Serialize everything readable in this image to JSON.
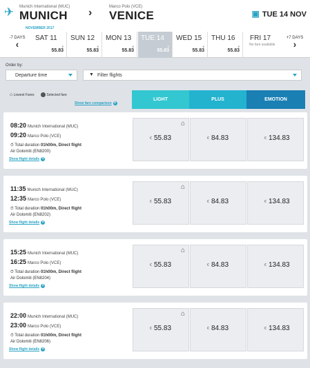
{
  "header": {
    "from_small": "Munich International (MUC)",
    "from_big": "MUNICH",
    "to_small": "Marco Polo (VCE)",
    "to_big": "VENICE",
    "date": "TUE 14 NOV"
  },
  "datebar": {
    "month": "NOVEMBER 2017",
    "prev_label": "-7 DAYS",
    "next_label": "+7 DAYS",
    "days": [
      {
        "name": "SAT 11",
        "currency": "€",
        "price": "55.83",
        "available": true
      },
      {
        "name": "SUN 12",
        "currency": "€",
        "price": "55.83",
        "available": true
      },
      {
        "name": "MON 13",
        "currency": "€",
        "price": "55.83",
        "available": true
      },
      {
        "name": "TUE 14",
        "currency": "€",
        "price": "55.83",
        "available": true
      },
      {
        "name": "WED 15",
        "currency": "€",
        "price": "55.83",
        "available": true
      },
      {
        "name": "THU 16",
        "currency": "€",
        "price": "55.83",
        "available": true
      },
      {
        "name": "FRI 17",
        "note": "No fare available",
        "available": false
      }
    ]
  },
  "filters": {
    "order_by_label": "Order by:",
    "order_value": "Departure time",
    "filter_label": "Filter flights",
    "lowest_fares": "Lowest Fares",
    "selected_fare": "Selected fare",
    "show_comparison": "Show fare comparison"
  },
  "fare_columns": [
    {
      "label": "LIGHT",
      "color": "#33c7d1"
    },
    {
      "label": "PLUS",
      "color": "#23b3cf"
    },
    {
      "label": "EMOTION",
      "color": "#1a7fb3"
    }
  ],
  "flights": [
    {
      "dep_time": "08:20",
      "dep_place": "Munich International (MUC)",
      "arr_time": "09:20",
      "arr_place": "Marco Polo (VCE)",
      "duration_label": "Total duration",
      "duration": "01h00m, Direct flight",
      "airline": "Air Dolomiti (EN8200)",
      "details": "Show flight details",
      "fares": [
        {
          "currency": "€",
          "price": "55.83"
        },
        {
          "currency": "€",
          "price": "84.83"
        },
        {
          "currency": "€",
          "price": "134.83"
        }
      ]
    },
    {
      "dep_time": "11:35",
      "dep_place": "Munich International (MUC)",
      "arr_time": "12:35",
      "arr_place": "Marco Polo (VCE)",
      "duration_label": "Total duration",
      "duration": "01h00m, Direct flight",
      "airline": "Air Dolomiti (EN8202)",
      "details": "Show flight details",
      "fares": [
        {
          "currency": "€",
          "price": "55.83"
        },
        {
          "currency": "€",
          "price": "84.83"
        },
        {
          "currency": "€",
          "price": "134.83"
        }
      ]
    },
    {
      "dep_time": "15:25",
      "dep_place": "Munich International (MUC)",
      "arr_time": "16:25",
      "arr_place": "Marco Polo (VCE)",
      "duration_label": "Total duration",
      "duration": "01h00m, Direct flight",
      "airline": "Air Dolomiti (EN8204)",
      "details": "Show flight details",
      "fares": [
        {
          "currency": "€",
          "price": "55.83"
        },
        {
          "currency": "€",
          "price": "84.83"
        },
        {
          "currency": "€",
          "price": "134.83"
        }
      ]
    },
    {
      "dep_time": "22:00",
      "dep_place": "Munich International (MUC)",
      "arr_time": "23:00",
      "arr_place": "Marco Polo (VCE)",
      "duration_label": "Total duration",
      "duration": "01h00m, Direct flight",
      "airline": "Air Dolomiti (EN8206)",
      "details": "Show flight details",
      "fares": [
        {
          "currency": "€",
          "price": "55.83"
        },
        {
          "currency": "€",
          "price": "84.83"
        },
        {
          "currency": "€",
          "price": "134.83"
        }
      ]
    }
  ]
}
